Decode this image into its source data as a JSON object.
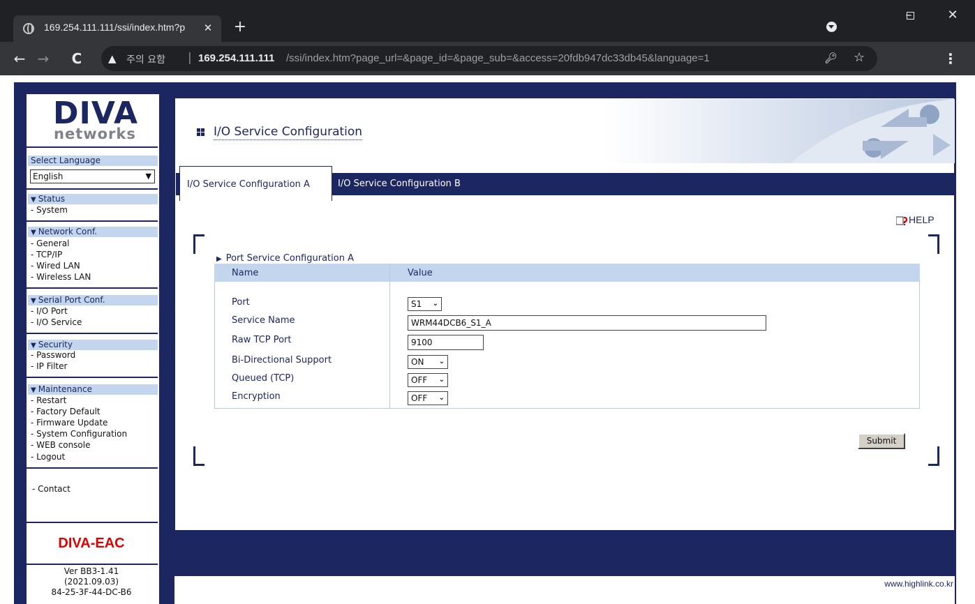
{
  "browser": {
    "tab_title": "169.254.111.111/ssi/index.htm?p",
    "security_label": "주의 요함",
    "url_host": "169.254.111.111",
    "url_path": "/ssi/index.htm?page_url=&page_id=&page_sub=&access=20fdb947dc33db45&language=1",
    "icons": [
      "globe-icon",
      "close-icon",
      "plus-icon",
      "back-icon",
      "forward-icon",
      "reload-icon",
      "warning-icon",
      "key-icon",
      "star-icon",
      "menu-icon",
      "minimize-icon",
      "maximize-icon",
      "close-window-icon"
    ]
  },
  "sidebar": {
    "logo_top": "DIVA",
    "logo_bottom": "networks",
    "select_language_label": "Select Language",
    "language_value": "English",
    "groups": [
      {
        "header": "Status",
        "items": [
          "- System"
        ]
      },
      {
        "header": "Network Conf.",
        "items": [
          "- General",
          "- TCP/IP",
          "- Wired LAN",
          "- Wireless LAN"
        ]
      },
      {
        "header": "Serial Port Conf.",
        "items": [
          "- I/O Port",
          "- I/O Service"
        ]
      },
      {
        "header": "Security",
        "items": [
          "- Password",
          "- IP Filter"
        ]
      },
      {
        "header": "Maintenance",
        "items": [
          "- Restart",
          "- Factory Default",
          "- Firmware Update",
          "- System Configuration",
          "- WEB console",
          "- Logout"
        ]
      }
    ],
    "contact": "-  Contact",
    "model": "DIVA-EAC",
    "version_lines": [
      "Ver BB3-1.41",
      "(2021.09.03)",
      "84-25-3F-44-DC-B6"
    ]
  },
  "main": {
    "title": "I/O Service Configuration",
    "tabs": [
      "I/O Service Configuration A",
      "I/O Service Configuration B"
    ],
    "help": "HELP",
    "section_title": "Port Service Configuration A",
    "columns": [
      "Name",
      "Value"
    ],
    "fields": {
      "port": {
        "label": "Port",
        "value": "S1"
      },
      "service_name": {
        "label": "Service Name",
        "value": "WRM44DCB6_S1_A"
      },
      "raw_tcp_port": {
        "label": "Raw TCP Port",
        "value": "9100"
      },
      "bidirectional": {
        "label": "Bi-Directional Support",
        "value": "ON"
      },
      "queued": {
        "label": "Queued (TCP)",
        "value": "OFF"
      },
      "encryption": {
        "label": "Encryption",
        "value": "OFF"
      }
    },
    "submit": "Submit",
    "footer_url": "www.highlink.co.kr"
  },
  "colors": {
    "navy": "#1c2761",
    "light_blue": "#c4d6ee",
    "model_red": "#e00000"
  }
}
